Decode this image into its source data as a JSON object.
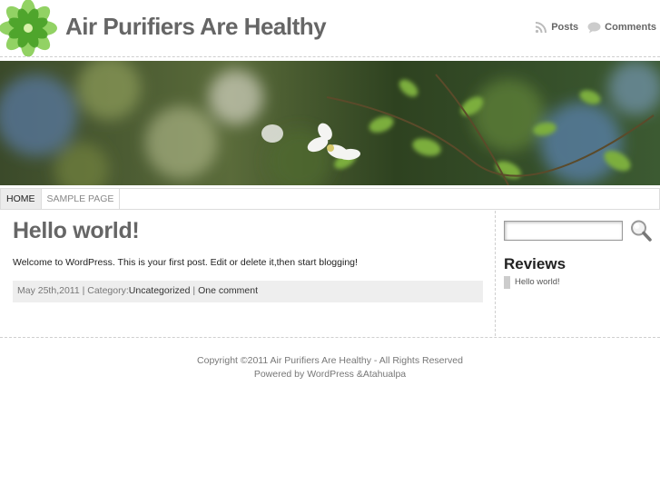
{
  "header": {
    "site_title": "Air Purifiers Are Healthy",
    "logo_icon": "green-flower-logo-icon",
    "feeds": [
      {
        "label": "Posts",
        "icon": "rss-icon"
      },
      {
        "label": "Comments",
        "icon": "speech-bubble-icon"
      }
    ]
  },
  "banner": {
    "icon": "flower-branch-photo"
  },
  "nav": {
    "items": [
      {
        "label": "HOME",
        "active": true
      },
      {
        "label": "SAMPLE PAGE",
        "active": false
      }
    ]
  },
  "post": {
    "title": "Hello world!",
    "body": "Welcome to WordPress. This is your first post. Edit or delete it,then start blogging!",
    "meta": {
      "date": "May 25th,2011",
      "sep1": " | ",
      "category_label": "Category:",
      "category": "Uncategorized",
      "sep2": " | ",
      "comments": "One comment"
    }
  },
  "sidebar": {
    "search": {
      "value": "",
      "icon": "magnifier-search-icon"
    },
    "widget_title": "Reviews",
    "items": [
      "Hello world!"
    ]
  },
  "footer": {
    "line1": "Copyright ©2011 Air Purifiers Are Healthy - All Rights Reserved",
    "line2": "Powered by WordPress &Atahualpa"
  },
  "colors": {
    "title_gray": "#666666",
    "meta_bg": "#eeeeee",
    "nav_active_bg": "#ececec",
    "logo_green": "#5cb82e"
  }
}
